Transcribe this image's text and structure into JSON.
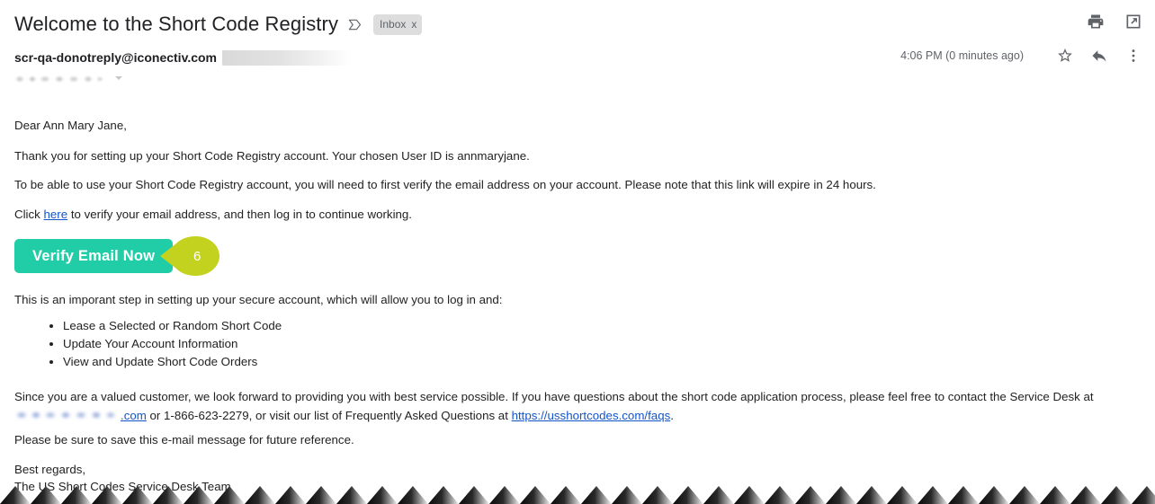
{
  "header": {
    "subject": "Welcome to the Short Code Registry",
    "important_marker_icon": "important-marker-icon",
    "label_chip": "Inbox",
    "label_chip_remove": "x",
    "print_icon": "print-icon",
    "open_in_new_icon": "open-in-new-window-icon"
  },
  "message_meta": {
    "sender_email": "scr-qa-donotreply@iconectiv.com",
    "sender_detail_redacted": "",
    "recipient_redacted": "",
    "recipient_caret_icon": "chevron-down-icon",
    "timestamp": "4:06 PM (0 minutes ago)",
    "star_icon": "star-icon",
    "reply_icon": "reply-icon",
    "more_icon": "more-options-icon"
  },
  "body": {
    "greeting": "Dear Ann Mary Jane,",
    "thanks": "Thank you for setting up your Short Code Registry account. Your chosen User ID is annmaryjane.",
    "verify_note": "To be able to use your Short Code Registry account, you will need to first verify the email address on your account. Please note that this link will expire in 24 hours.",
    "click_prefix": "Click ",
    "click_link": "here",
    "click_suffix": " to verify your email address, and then log in to continue working.",
    "cta_label": "Verify Email Now",
    "callout_number": "6",
    "important_intro": "This is an imporant step in setting up your secure account, which will allow you to log in and:",
    "bullets": [
      "Lease a Selected or Random Short Code",
      "Update Your Account Information",
      "View and Update Short Code Orders"
    ],
    "contact_part1": "Since you are a valued customer, we look forward to providing you with best service possible. If you have questions about the short code application process, please feel free to contact the Service Desk at ",
    "contact_email_redacted_suffix": ".com",
    "contact_part2": " or 1-866-623-2279, or visit our list of Frequently Asked Questions at ",
    "faq_link": "https://usshortcodes.com/faqs",
    "contact_part3": ".",
    "save_note": "Please be sure to save this e-mail message for future reference.",
    "regards": "Best regards,",
    "team": "The US Short Codes Service Desk Team"
  },
  "colors": {
    "cta_background": "#21cda6",
    "cta_text": "#ffffff",
    "callout_background": "#c2d21e",
    "link": "#1155cc",
    "chip_background": "#ddddde",
    "body_text": "#222222",
    "meta_text": "#5f6368",
    "torn_edge": "#101010"
  }
}
